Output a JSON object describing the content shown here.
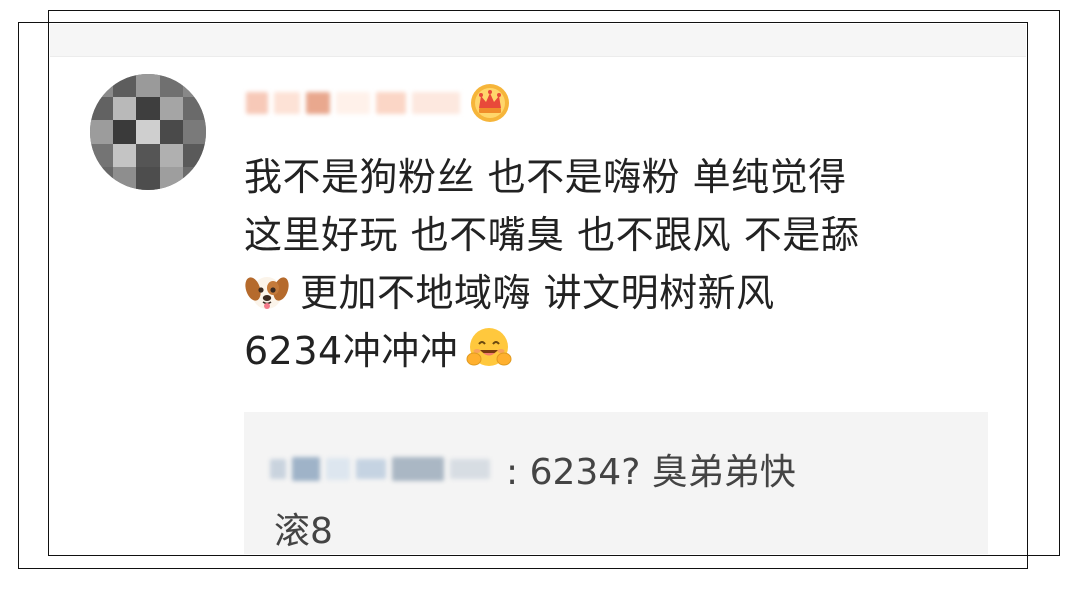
{
  "comment": {
    "lines": [
      "我不是狗粉丝 也不是嗨粉 单纯觉得",
      "这里好玩 也不嘴臭 也不跟风 不是舔",
      "更加不地域嗨 讲文明树新风",
      "6234冲冲冲"
    ],
    "emoji_dog": "dog-face-emoji",
    "emoji_smile": "hugging-face-emoji"
  },
  "reply": {
    "text": ": 6234? 臭弟弟快",
    "text_continued": "滚8"
  },
  "badge_icon": "crown-icon"
}
